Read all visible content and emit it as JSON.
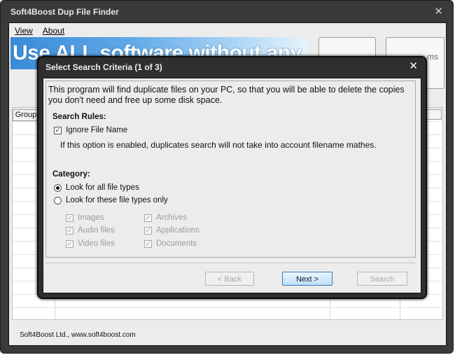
{
  "window": {
    "title": "Soft4Boost Dup File Finder",
    "close_glyph": "✕"
  },
  "menu": {
    "view": "View",
    "about": "About"
  },
  "banner": {
    "text": "Use ALL software without any"
  },
  "toolbar": {
    "box2_text": "ms"
  },
  "grid": {
    "group_label": "Group"
  },
  "statusbar": {
    "text": "Soft4Boost Ltd., www.soft4boost.com"
  },
  "dialog": {
    "title": "Select Search Criteria (1 of 3)",
    "close_glyph": "✕",
    "intro": "This program will find duplicate files on your PC, so that you will be able to delete the copies you don't need and free up some disk space.",
    "search_rules": {
      "heading": "Search Rules:",
      "ignore_file_name": {
        "label": "Ignore File Name",
        "checked": true
      },
      "note": "If this option is enabled, duplicates search will not take into account filename mathes."
    },
    "category": {
      "heading": "Category:",
      "options": [
        {
          "label": "Look for all file types",
          "selected": true
        },
        {
          "label": "Look for these file types only",
          "selected": false
        }
      ],
      "file_types_left": [
        {
          "label": "Images",
          "checked": true
        },
        {
          "label": "Audio files",
          "checked": true
        },
        {
          "label": "Video files",
          "checked": true
        }
      ],
      "file_types_right": [
        {
          "label": "Archives",
          "checked": true
        },
        {
          "label": "Applications",
          "checked": true
        },
        {
          "label": "Documents",
          "checked": true
        }
      ]
    },
    "buttons": {
      "back": "< Back",
      "next": "Next >",
      "search": "Search"
    },
    "check_glyph": "✓"
  }
}
